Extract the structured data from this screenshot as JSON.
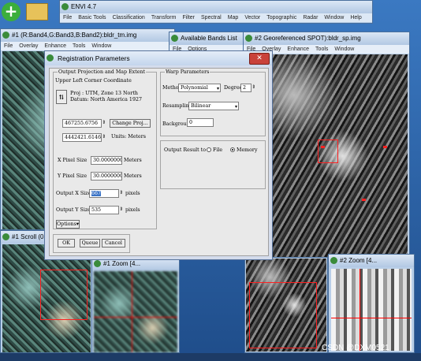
{
  "envi": {
    "title": "ENVI 4.7",
    "menu": [
      "File",
      "Basic Tools",
      "Classification",
      "Transform",
      "Filter",
      "Spectral",
      "Map",
      "Vector",
      "Topographic",
      "Radar",
      "Window",
      "Help"
    ]
  },
  "win1": {
    "title": "#1 (R:Band4,G:Band3,B:Band2):bldr_tm.img",
    "menu": [
      "File",
      "Overlay",
      "Enhance",
      "Tools",
      "Window"
    ]
  },
  "bands": {
    "title": "Available Bands List",
    "menu": [
      "File",
      "Options"
    ]
  },
  "win2": {
    "title": "#2 Georeferenced SPOT):bldr_sp.img",
    "menu": [
      "File",
      "Overlay",
      "Enhance",
      "Tools",
      "Window"
    ]
  },
  "scroll1": {
    "title": "#1 Scroll (0.5..."
  },
  "zoom1": {
    "title": "#1 Zoom [4..."
  },
  "zoom2": {
    "title": "#2 Zoom [4..."
  },
  "watermark": "CSDN @DXM0521",
  "dialog": {
    "title": "Registration Parameters",
    "left_group": "Output Projection and Map Extent",
    "ul_label": "Upper Left Corner Coordinate",
    "proj": "Proj  : UTM, Zone 13 North",
    "datum": "Datum: North America 1927",
    "x_coord": "467255.6756",
    "change_proj": "Change Proj...",
    "y_coord": "4442421.6146",
    "units": "Units: Meters",
    "x_pixel_label": "X Pixel Size",
    "x_pixel": "30.00000000",
    "y_pixel_label": "Y Pixel Size",
    "y_pixel": "30.00000000",
    "meters": "Meters",
    "out_x_label": "Output X Size",
    "out_x": "667",
    "out_y_label": "Output Y Size",
    "out_y": "535",
    "pixels": "pixels",
    "options": "Options",
    "ok": "OK",
    "queue": "Queue",
    "cancel": "Cancel",
    "warp_group": "Warp Parameters",
    "method_label": "Method",
    "method": "Polynomial",
    "degree_label": "Degree",
    "degree": "2",
    "resampling_label": "Resampling",
    "resampling": "Bilinear",
    "background_label": "Background",
    "background": "0",
    "output_label": "Output Result to",
    "file": "File",
    "memory": "Memory"
  }
}
